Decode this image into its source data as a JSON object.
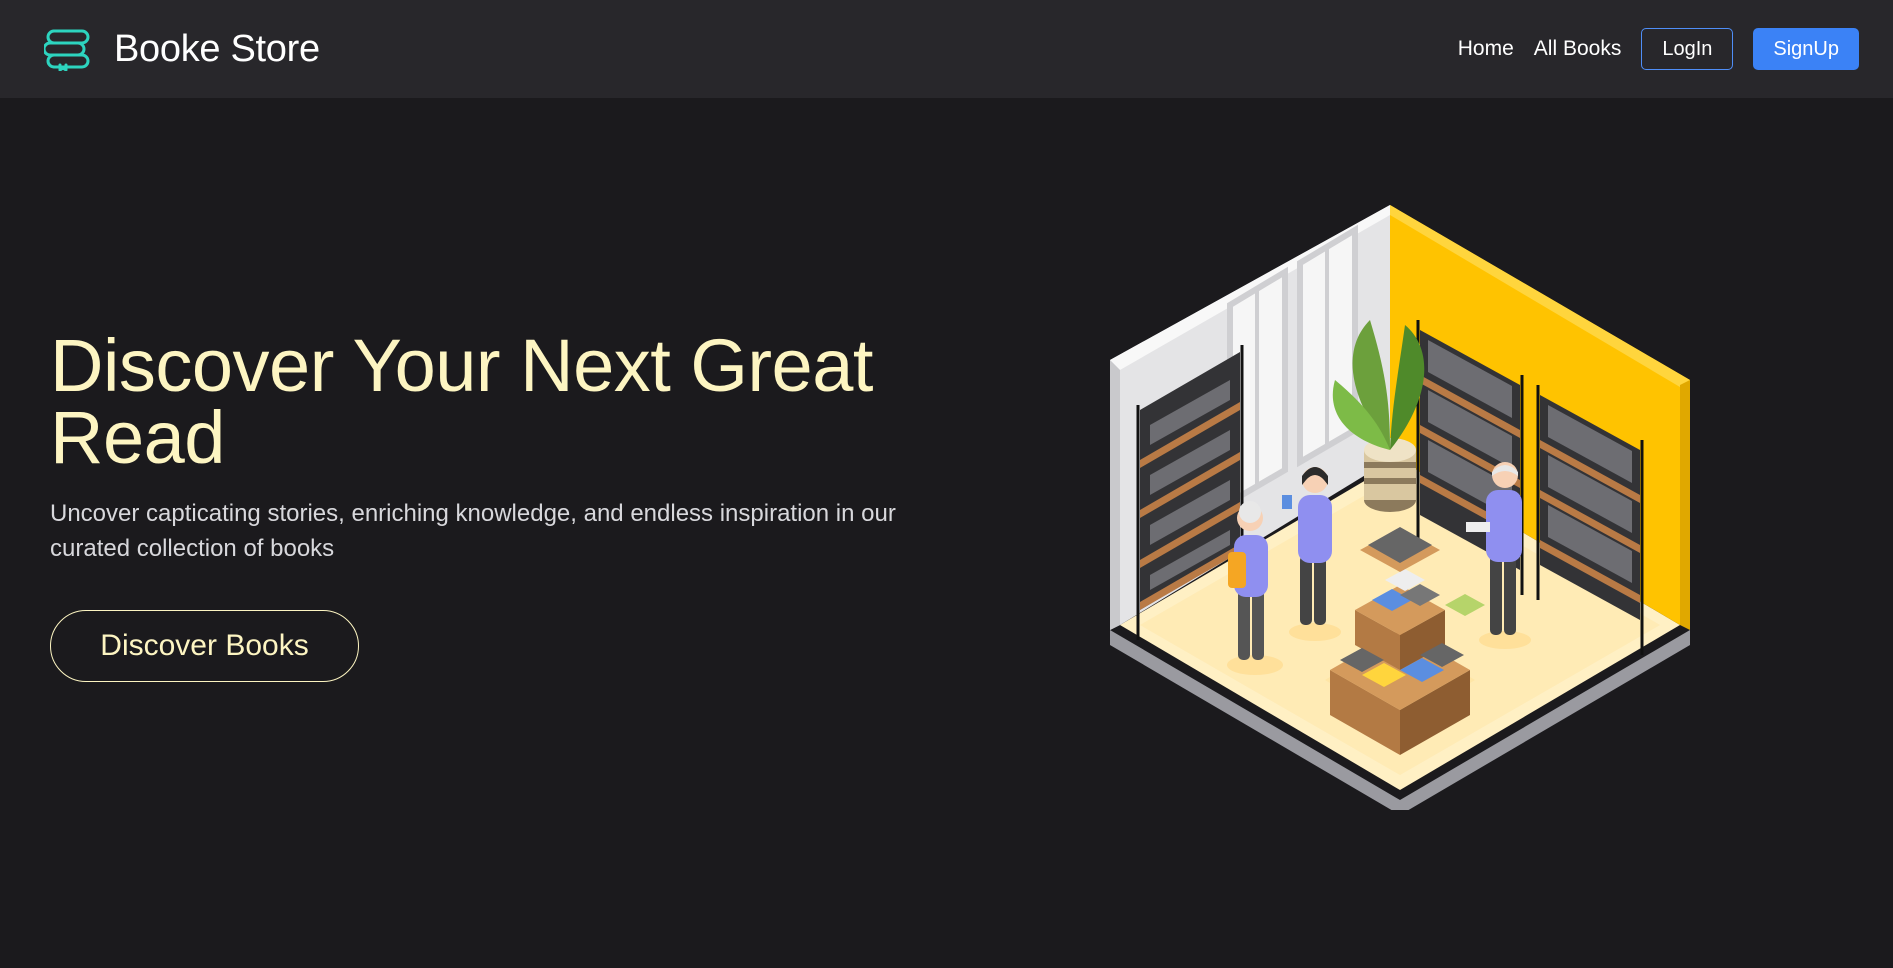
{
  "nav": {
    "brand": "Booke Store",
    "links": [
      "Home",
      "All Books"
    ],
    "login": "LogIn",
    "signup": "SignUp"
  },
  "hero": {
    "title": "Discover Your Next Great Read",
    "subtitle": "Uncover capticating stories, enriching knowledge, and endless inspiration in our curated collection of books",
    "cta": "Discover Books"
  },
  "colors": {
    "page_bg": "#1b1a1d",
    "nav_bg": "#28272b",
    "accent_cream": "#fdf5c2",
    "brand_teal": "#2dd4bf",
    "primary_blue": "#3b82f6",
    "wall_yellow": "#ffc300"
  },
  "icons": {
    "brand": "books-stack-icon"
  }
}
